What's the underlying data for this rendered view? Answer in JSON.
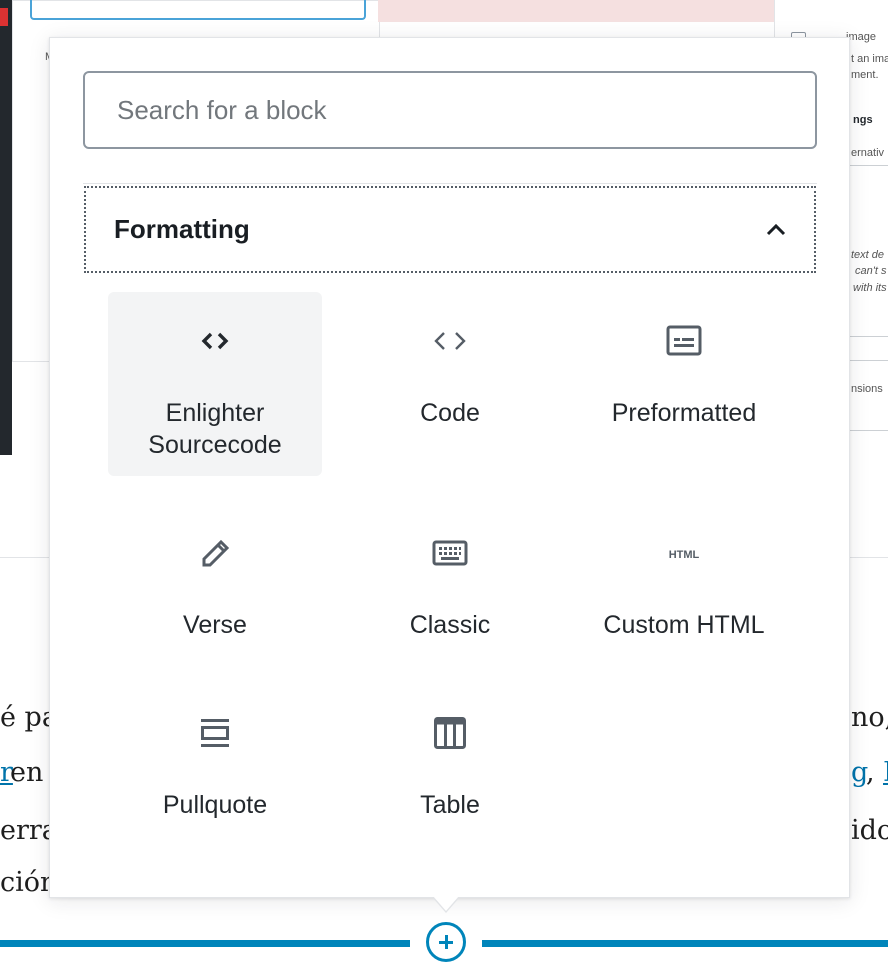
{
  "search": {
    "placeholder": "Search for a block"
  },
  "panel": {
    "title": "Formatting",
    "expanded": true
  },
  "blocks": [
    {
      "label": "Enlighter\nSourcecode",
      "icon": "code-brackets-icon",
      "selected": true
    },
    {
      "label": "Code",
      "icon": "code-icon"
    },
    {
      "label": "Preformatted",
      "icon": "preformatted-icon"
    },
    {
      "label": "Verse",
      "icon": "pencil-icon"
    },
    {
      "label": "Classic",
      "icon": "keyboard-icon"
    },
    {
      "label": "Custom HTML",
      "icon": "html-icon"
    },
    {
      "label": "Pullquote",
      "icon": "pullquote-icon"
    },
    {
      "label": "Table",
      "icon": "table-icon"
    }
  ],
  "background": {
    "sidebar": {
      "text_1": "image",
      "text_2": "t an ima",
      "text_3": "ment.",
      "heading": "ngs",
      "text_4": "ernativ",
      "text_5": "text de",
      "text_6": "can't s",
      "text_7": "with its",
      "text_8": "nsions"
    },
    "media_label": "M",
    "paragraph": {
      "line1_left": "é pa",
      "line1_right": "no,",
      "line2_left_link": "r",
      "line2_left": " en",
      "line2_right_link": "g",
      "line2_right": ", ",
      "line2_right_link2": "I",
      "line3_left": "erra",
      "line3_right": "ido",
      "line4_left": "ción"
    }
  },
  "colors": {
    "accent": "#0085ba",
    "link": "#0073aa",
    "text": "#23282d"
  }
}
